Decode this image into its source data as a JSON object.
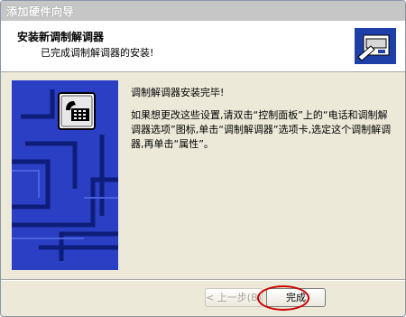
{
  "window": {
    "title": "添加硬件向导"
  },
  "header": {
    "title": "安装新调制解调器",
    "subtitle": "已完成调制解调器的安装!"
  },
  "content": {
    "paragraph1": "调制解调器安装完毕!",
    "paragraph2": "如果想更改这些设置,请双击“控制面板”上的“电话和调制解调器选项”图标,单击“调制解调器”选项卡,选定这个调制解调器,再单击“属性”。"
  },
  "buttons": {
    "back": "< 上一步(B)",
    "finish": "完成"
  },
  "colors": {
    "side_panel": "#2a3fc4",
    "highlight": "#cc0000",
    "titlebar": "#c6c6c6",
    "dialog_bg": "#ece9d8"
  }
}
